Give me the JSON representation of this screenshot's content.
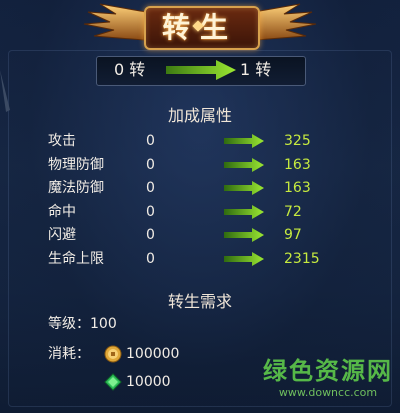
{
  "title": "转生",
  "rebirth": {
    "from": "0 转",
    "to": "1 转"
  },
  "attributes_section": {
    "heading": "加成属性",
    "rows": [
      {
        "label": "攻击",
        "from": "0",
        "to": "325"
      },
      {
        "label": "物理防御",
        "from": "0",
        "to": "163"
      },
      {
        "label": "魔法防御",
        "from": "0",
        "to": "163"
      },
      {
        "label": "命中",
        "from": "0",
        "to": "72"
      },
      {
        "label": "闪避",
        "from": "0",
        "to": "97"
      },
      {
        "label": "生命上限",
        "from": "0",
        "to": "2315"
      }
    ]
  },
  "requirements_section": {
    "heading": "转生需求",
    "level": "等级：100",
    "cost_label": "消耗：",
    "gold_cost": "100000",
    "gem_cost": "10000"
  },
  "watermark": {
    "title": "绿色资源网",
    "url": "www.downcc.com"
  },
  "icons": {
    "arrow": "green-arrow-icon",
    "coin": "gold-coin-icon",
    "gem": "green-gem-icon"
  },
  "colors": {
    "value_green": "#c6ea3f",
    "arrow_green": "#7ed321",
    "title_gold": "#d7a14d",
    "watermark_green": "#56b848"
  }
}
